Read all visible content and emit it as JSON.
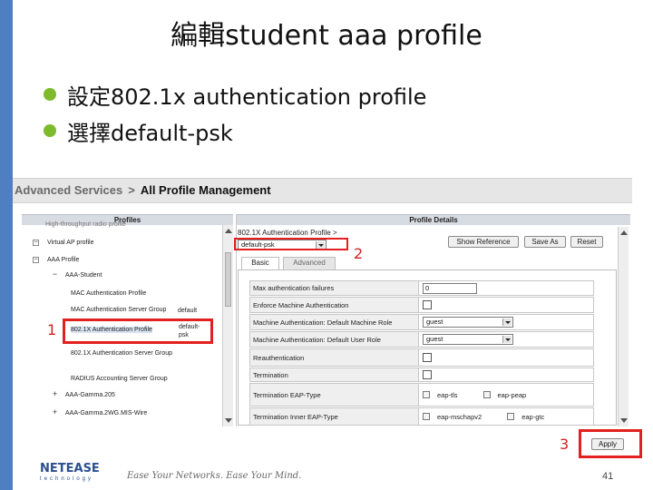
{
  "slide": {
    "title": "編輯student aaa profile",
    "bullets": [
      "設定802.1x authentication profile",
      "選擇default-psk"
    ],
    "page_number": "41",
    "slogan": "Ease Your Networks. Ease Your Mind.",
    "logo_main": "NETEASE",
    "logo_sub": "technology"
  },
  "breadcrumb": {
    "section": "Advanced Services",
    "separator": ">",
    "page": "All Profile Management"
  },
  "profiles_panel": {
    "header": "Profiles",
    "items": [
      {
        "label": "High-throughput radio profile"
      },
      {
        "label": "Virtual AP profile"
      },
      {
        "label": "AAA Profile"
      },
      {
        "label": "AAA-Student"
      },
      {
        "label": "MAC Authentication Profile"
      },
      {
        "label": "MAC Authentication Server Group",
        "value": "default"
      },
      {
        "label": "802.1X Authentication Profile",
        "value": "default-psk"
      },
      {
        "label": "802.1X Authentication Server Group"
      },
      {
        "label": "RADIUS Accounting Server Group"
      },
      {
        "label": "AAA-Gamma.205"
      },
      {
        "label": "AAA-Gamma.2WG.MIS-Wire"
      }
    ]
  },
  "details_panel": {
    "header": "Profile Details",
    "profile_title": "802.1X Authentication Profile >",
    "profile_select": "default-psk",
    "buttons": {
      "show_reference": "Show Reference",
      "save_as": "Save As",
      "reset": "Reset"
    },
    "tabs": [
      "Basic",
      "Advanced"
    ],
    "fields": [
      {
        "label": "Max authentication failures",
        "value": "0"
      },
      {
        "label": "Enforce Machine Authentication"
      },
      {
        "label": "Machine Authentication: Default Machine Role",
        "value": "guest"
      },
      {
        "label": "Machine Authentication: Default User Role",
        "value": "guest"
      },
      {
        "label": "Reauthentication"
      },
      {
        "label": "Termination"
      },
      {
        "label": "Termination EAP-Type",
        "options": [
          "eap-tls",
          "eap-peap"
        ]
      },
      {
        "label": "Termination Inner EAP-Type",
        "options": [
          "eap-mschapv2",
          "eap-gtc"
        ]
      }
    ],
    "apply_label": "Apply"
  },
  "annotations": {
    "one": "1",
    "two": "2",
    "three": "3"
  },
  "colors": {
    "accent_bar": "#4f7fc0",
    "bullet": "#7dbb2c",
    "highlight": "#e32020",
    "logo": "#2c4f8e"
  }
}
